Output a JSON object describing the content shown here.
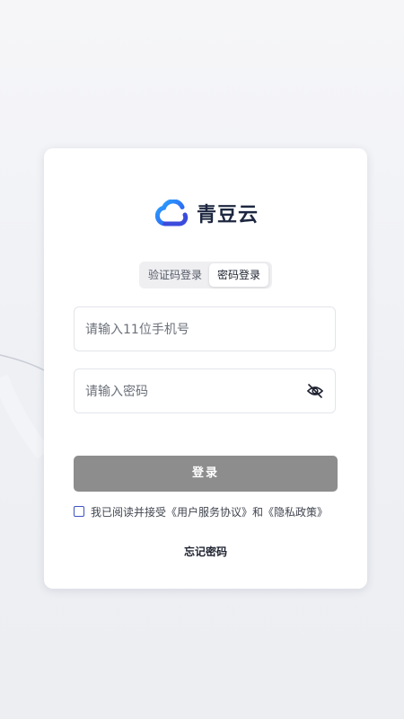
{
  "brand": {
    "name": "青豆云",
    "logo_icon": "cloud-logo-icon",
    "colors": {
      "logo_blue": "#2f6bff",
      "logo_dark": "#1d2740"
    }
  },
  "tabs": [
    {
      "label": "验证码登录",
      "active": false
    },
    {
      "label": "密码登录",
      "active": true
    }
  ],
  "phone_field": {
    "value": "",
    "placeholder": "请输入11位手机号"
  },
  "password_field": {
    "value": "",
    "placeholder": "请输入密码",
    "toggle_icon": "eye-off-icon"
  },
  "login_button": {
    "label": "登录",
    "color": "#8d8d8d"
  },
  "agreement": {
    "checked": false,
    "text_prefix": "我已阅读并接受",
    "user_agreement": "《用户服务协议》",
    "conjunction": "和",
    "privacy_policy": "《隐私政策》",
    "checkbox_color": "#3d52c4"
  },
  "forgot_password": {
    "label": "忘记密码"
  }
}
